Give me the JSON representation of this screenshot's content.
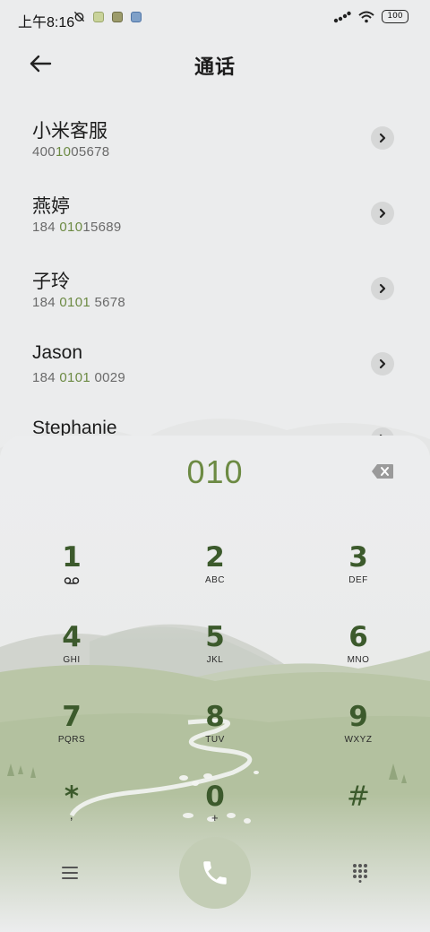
{
  "status_bar": {
    "time": "上午8:16",
    "battery": "100",
    "notification_colors": [
      "#c9d39a",
      "#9c9b6a",
      "#7fa0c8"
    ]
  },
  "header": {
    "title": "通话"
  },
  "contacts": [
    {
      "name": "小米客服",
      "number_pre": "400",
      "number_hl": "10",
      "number_post": "05678"
    },
    {
      "name": "燕婷",
      "number_pre": "184 ",
      "number_hl": "010",
      "number_post": "15689"
    },
    {
      "name": "子玲",
      "number_pre": "184 ",
      "number_hl": "0101",
      "number_post": " 5678"
    },
    {
      "name": "Jason",
      "number_pre": "184 ",
      "number_hl": "0101",
      "number_post": " 0029"
    },
    {
      "name": "Stephanie",
      "number_pre": "",
      "number_hl": "",
      "number_post": ""
    }
  ],
  "dialpad": {
    "dialed": "010",
    "keys": [
      {
        "digit": "1",
        "letters": "",
        "sub_icon": "voicemail-icon"
      },
      {
        "digit": "2",
        "letters": "ABC"
      },
      {
        "digit": "3",
        "letters": "DEF"
      },
      {
        "digit": "4",
        "letters": "GHI"
      },
      {
        "digit": "5",
        "letters": "JKL"
      },
      {
        "digit": "6",
        "letters": "MNO"
      },
      {
        "digit": "7",
        "letters": "PQRS"
      },
      {
        "digit": "8",
        "letters": "TUV"
      },
      {
        "digit": "9",
        "letters": "WXYZ"
      },
      {
        "digit": "*",
        "letters": ","
      },
      {
        "digit": "0",
        "letters": "+"
      },
      {
        "digit": "#",
        "letters": ""
      }
    ]
  },
  "colors": {
    "accent_green": "#6c8a43",
    "digit_green": "#3c5a2c",
    "call_button": "#c3cdb5"
  },
  "icons": {
    "back": "back-arrow-icon",
    "detail": "chevron-right-icon",
    "backspace": "backspace-icon",
    "call": "phone-icon",
    "menu": "menu-icon",
    "keypad": "dialpad-icon"
  }
}
